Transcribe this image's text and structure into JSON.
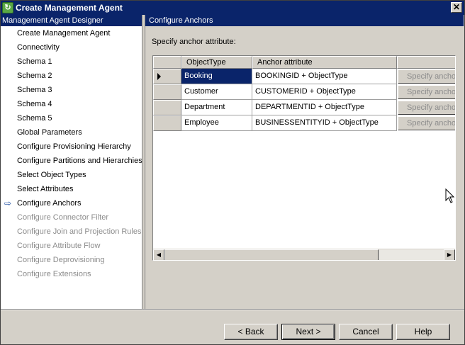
{
  "window": {
    "title": "Create Management Agent",
    "close_label": "✕"
  },
  "sidebar": {
    "header": "Management Agent Designer",
    "items": [
      {
        "label": "Create Management Agent",
        "enabled": true
      },
      {
        "label": "Connectivity",
        "enabled": true
      },
      {
        "label": "Schema 1",
        "enabled": true
      },
      {
        "label": "Schema 2",
        "enabled": true
      },
      {
        "label": "Schema 3",
        "enabled": true
      },
      {
        "label": "Schema 4",
        "enabled": true
      },
      {
        "label": "Schema 5",
        "enabled": true
      },
      {
        "label": "Global Parameters",
        "enabled": true
      },
      {
        "label": "Configure Provisioning Hierarchy",
        "enabled": true
      },
      {
        "label": "Configure Partitions and Hierarchies",
        "enabled": true
      },
      {
        "label": "Select Object Types",
        "enabled": true
      },
      {
        "label": "Select Attributes",
        "enabled": true
      },
      {
        "label": "Configure Anchors",
        "enabled": true,
        "current": true
      },
      {
        "label": "Configure Connector Filter",
        "enabled": false
      },
      {
        "label": "Configure Join and Projection Rules",
        "enabled": false
      },
      {
        "label": "Configure Attribute Flow",
        "enabled": false
      },
      {
        "label": "Configure Deprovisioning",
        "enabled": false
      },
      {
        "label": "Configure Extensions",
        "enabled": false
      }
    ]
  },
  "main": {
    "header": "Configure Anchors",
    "prompt": "Specify anchor attribute:",
    "table": {
      "columns": [
        "ObjectType",
        "Anchor attribute"
      ],
      "rows": [
        {
          "object_type": "Booking",
          "anchor": "BOOKINGID + ObjectType",
          "button": "Specify anchor",
          "selected": true
        },
        {
          "object_type": "Customer",
          "anchor": "CUSTOMERID + ObjectType",
          "button": "Specify anchor"
        },
        {
          "object_type": "Department",
          "anchor": "DEPARTMENTID + ObjectType",
          "button": "Specify anchor"
        },
        {
          "object_type": "Employee",
          "anchor": "BUSINESSENTITYID + ObjectType",
          "button": "Specify anchor"
        }
      ]
    }
  },
  "footer": {
    "back": "< Back",
    "next": "Next >",
    "cancel": "Cancel",
    "help": "Help"
  },
  "icons": {
    "current_step": "arrow-right-icon",
    "app": "wizard-app-icon"
  },
  "colors": {
    "titlebar": "#0a246a",
    "face": "#d4d0c8",
    "disabled_text": "#8c8c8c",
    "accent_arrow": "#1f4fa3"
  }
}
